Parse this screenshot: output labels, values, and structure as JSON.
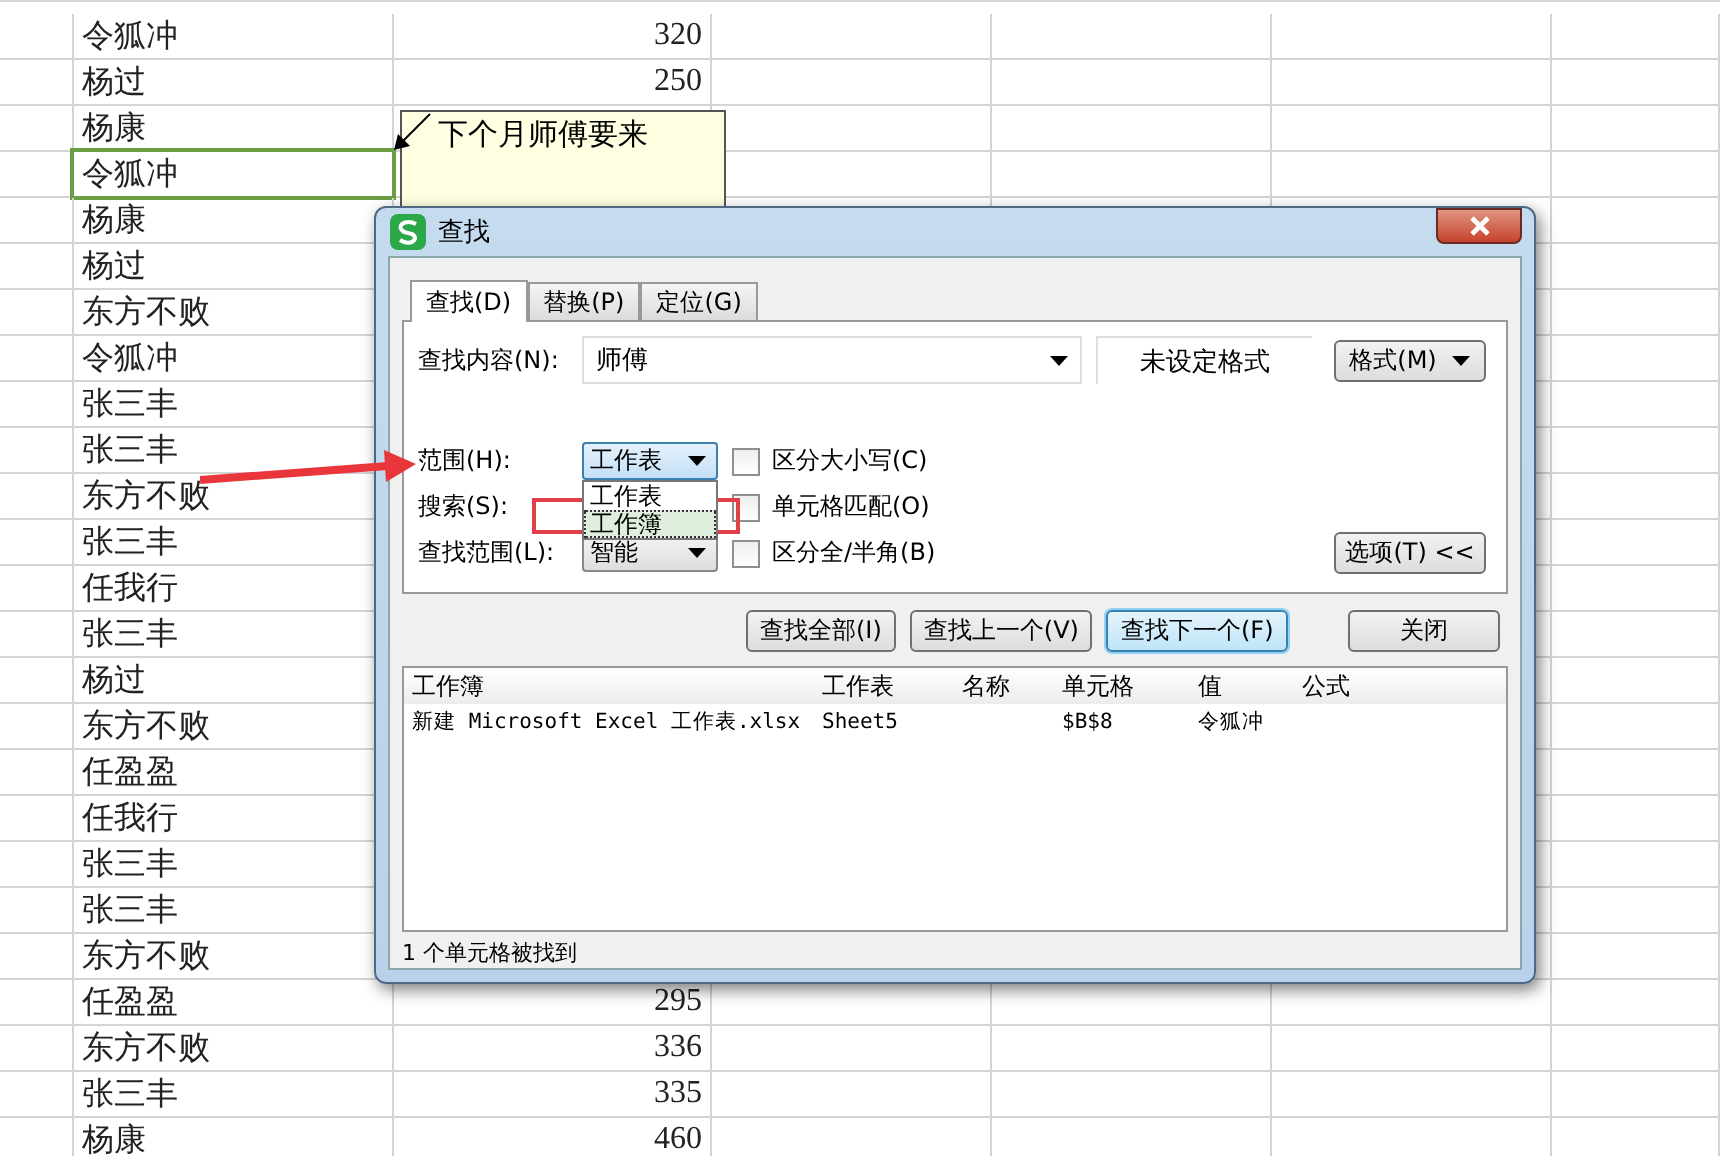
{
  "sheet": {
    "rows": [
      {
        "name": "令狐冲",
        "value": "320",
        "selected": false
      },
      {
        "name": "杨过",
        "value": "250",
        "selected": false
      },
      {
        "name": "杨康",
        "selected": false
      },
      {
        "name": "令狐冲",
        "selected": true
      },
      {
        "name": "杨康",
        "selected": false
      },
      {
        "name": "杨过",
        "selected": false
      },
      {
        "name": "东方不败",
        "selected": false
      },
      {
        "name": "令狐冲",
        "selected": false
      },
      {
        "name": "张三丰",
        "selected": false
      },
      {
        "name": "张三丰",
        "selected": false
      },
      {
        "name": "东方不败",
        "selected": false
      },
      {
        "name": "张三丰",
        "selected": false
      },
      {
        "name": "任我行",
        "selected": false
      },
      {
        "name": "张三丰",
        "selected": false
      },
      {
        "name": "杨过",
        "selected": false
      },
      {
        "name": "东方不败",
        "selected": false
      },
      {
        "name": "任盈盈",
        "selected": false
      },
      {
        "name": "任我行",
        "selected": false
      },
      {
        "name": "张三丰",
        "selected": false
      },
      {
        "name": "张三丰",
        "selected": false
      },
      {
        "name": "东方不败",
        "selected": false
      },
      {
        "name": "任盈盈",
        "value": "295",
        "selected": false
      },
      {
        "name": "东方不败",
        "value": "336",
        "selected": false
      },
      {
        "name": "张三丰",
        "value": "335",
        "selected": false
      },
      {
        "name": "杨康",
        "value": "460",
        "selected": false
      }
    ]
  },
  "comment": {
    "text": "下个月师傅要来"
  },
  "dialog": {
    "title": "查找",
    "tabs": [
      {
        "label": "查找(D)",
        "selected": true
      },
      {
        "label": "替换(P)",
        "selected": false
      },
      {
        "label": "定位(G)",
        "selected": false
      }
    ],
    "find_what": {
      "label": "查找内容(N):",
      "value": "师傅"
    },
    "format_preview": "未设定格式",
    "format_button": "格式(M)",
    "options": [
      {
        "label": "范围(H):",
        "dropdown": "工作表",
        "expanded": true,
        "checkbox": "区分大小写(C)",
        "checked": false
      },
      {
        "label": "搜索(S):",
        "checkbox": "单元格匹配(O)",
        "checked": false
      },
      {
        "label": "查找范围(L):",
        "dropdown": "智能",
        "expanded": false,
        "checkbox": "区分全/半角(B)",
        "checked": false
      }
    ],
    "dropdown_list": [
      {
        "label": "工作表",
        "selected": false
      },
      {
        "label": "工作簿",
        "selected": true
      }
    ],
    "options_button": "选项(T) <<",
    "buttons": [
      {
        "label": "查找全部(I)",
        "focused": false
      },
      {
        "label": "查找上一个(V)",
        "focused": false
      },
      {
        "label": "查找下一个(F)",
        "focused": true
      }
    ],
    "close_button": "关闭",
    "results": {
      "columns": [
        "工作簿",
        "工作表",
        "名称",
        "单元格",
        "值",
        "公式"
      ],
      "rows": [
        {
          "workbook": "新建 Microsoft Excel 工作表.xlsx",
          "sheet": "Sheet5",
          "cell": "$B$8",
          "value": "令狐冲"
        }
      ]
    },
    "status": "1 个单元格被找到"
  }
}
